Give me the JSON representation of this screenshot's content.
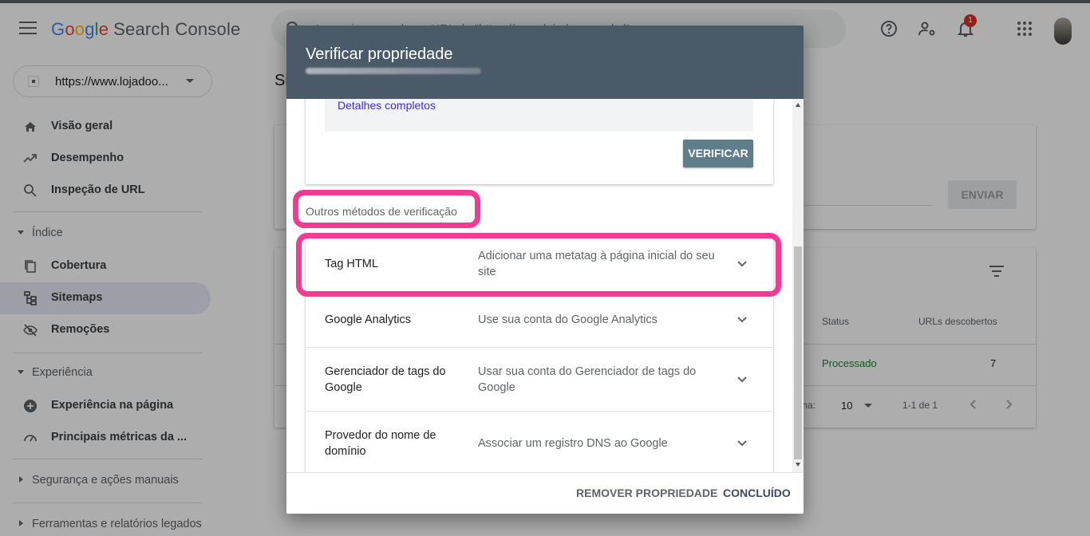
{
  "app": {
    "title_parts": [
      "G",
      "o",
      "o",
      "g",
      "l",
      "e"
    ],
    "product": "Search Console",
    "search_placeholder": "Inspecionar qualquer URL de \"https://www.lojadoo.com.br/\"",
    "notifications_count": "1"
  },
  "sidebar": {
    "property": "https://www.lojadoo...",
    "items": [
      {
        "label": "Visão geral",
        "icon": "home-icon"
      },
      {
        "label": "Desempenho",
        "icon": "trending-up-icon"
      },
      {
        "label": "Inspeção de URL",
        "icon": "search-icon"
      }
    ],
    "group_indice": "Índice",
    "indice_items": [
      {
        "label": "Cobertura",
        "icon": "copy-icon"
      },
      {
        "label": "Sitemaps",
        "icon": "sitemap-icon"
      },
      {
        "label": "Remoções",
        "icon": "eye-off-icon"
      }
    ],
    "group_experiencia": "Experiência",
    "experiencia_items": [
      {
        "label": "Experiência na página",
        "icon": "plus-circle-icon"
      },
      {
        "label": "Principais métricas da ...",
        "icon": "gauge-icon"
      }
    ],
    "group_seguranca": "Segurança e ações manuais",
    "group_ferramentas": "Ferramentas e relatórios legados"
  },
  "main": {
    "page_title_fragment": "Si",
    "enviar": "ENVIAR",
    "table": {
      "headers": [
        "Status",
        "URLs descobertos"
      ],
      "row": [
        "Processado",
        "7"
      ],
      "pagination_label": "gina:",
      "rows_per_page": "10",
      "range": "1-1 de 1"
    }
  },
  "dialog": {
    "title": "Verificar propriedade",
    "details_link": "Detalhes completos",
    "verify_button": "VERIFICAR",
    "other_methods_title": "Outros métodos de verificação",
    "methods": [
      {
        "name": "Tag HTML",
        "desc": "Adicionar uma metatag à página inicial do seu site"
      },
      {
        "name": "Google Analytics",
        "desc": "Use sua conta do Google Analytics"
      },
      {
        "name": "Gerenciador de tags do Google",
        "desc": "Usar sua conta do Gerenciador de tags do Google"
      },
      {
        "name": "Provedor do nome de domínio",
        "desc": "Associar um registro DNS ao Google"
      }
    ],
    "remove_button": "REMOVER PROPRIEDADE",
    "done_button": "CONCLUÍDO"
  },
  "colors": {
    "header_dialog": "#4a5a68",
    "highlight": "#f53995",
    "link": "#3d2bd6",
    "status_ok": "#188038"
  }
}
